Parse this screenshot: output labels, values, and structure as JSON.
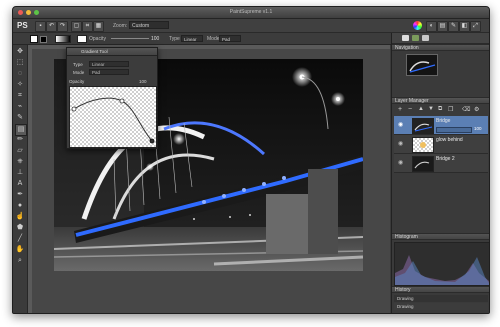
{
  "window": {
    "title": "PaintSupreme v1.1"
  },
  "toolbar": {
    "logo": "PS",
    "zoom_label": "Zoom:",
    "zoom_value": "Custom"
  },
  "options": {
    "opacity_label": "Opacity",
    "opacity_value": "100",
    "type_label": "Type",
    "type_value": "Linear",
    "mode_label": "Mode",
    "mode_value": "Pad"
  },
  "dialog": {
    "title": "Gradient Tool",
    "type_label": "Type",
    "type_value": "Linear",
    "mode_label": "Mode",
    "mode_value": "Pad",
    "opacity_label": "Opacity",
    "opacity_value": "100"
  },
  "panels": {
    "navigation": "Navigation",
    "layers": "Layer Manager",
    "histogram": "Histogram",
    "history": "History"
  },
  "layers": [
    {
      "name": "Bridge",
      "opacity": "100",
      "selected": true
    },
    {
      "name": "glow behind",
      "selected": false
    },
    {
      "name": "Bridge 2",
      "selected": false
    }
  ],
  "history": [
    "Drawing",
    "Drawing"
  ],
  "colors": {
    "accent": "#2f6bff",
    "selection": "#5b7fb4"
  }
}
